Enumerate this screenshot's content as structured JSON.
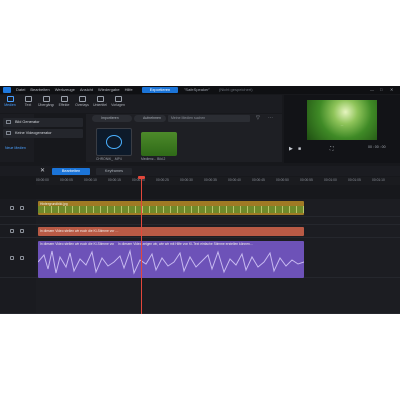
{
  "menu": {
    "items": [
      "Datei",
      "Bearbeiten",
      "Werkzeuge",
      "Ansicht",
      "Wiedergabe",
      "Hilfe"
    ]
  },
  "topbar": {
    "export_label": "Exportieren",
    "project_name": "\"SafeSpeaker\"",
    "project_status": "(Nicht gespeichert)"
  },
  "toolbar": {
    "tools": [
      "Medien",
      "Text",
      "Übergänge",
      "Effekte",
      "Overlays",
      "Untertitel",
      "Vorlagen"
    ]
  },
  "leftpanel": {
    "buttons": [
      "Bild Generator",
      "Keine Videogenerator"
    ],
    "link": "Neue Medien"
  },
  "media": {
    "tab_import": "Importieren",
    "tab_record": "Aufnehmen",
    "search_placeholder": "Meine Medien suchen",
    "thumb1_caption": "CHRONIK_ .MP4",
    "thumb2_caption": "Medienz... Bild.2"
  },
  "preview": {
    "overlay_text": "…",
    "timecode": "00 : 00 : 00"
  },
  "timeline": {
    "tabs": [
      "Bearbeiten",
      "Keyframes"
    ],
    "ticks": [
      "00:00:00",
      "00:00:05",
      "00:00:10",
      "00:00:15",
      "00:00:20",
      "00:00:25",
      "00:00:30",
      "00:00:35",
      "00:00:40",
      "00:00:45",
      "00:00:50",
      "00:00:55",
      "00:01:00",
      "00:01:05",
      "00:01:10"
    ],
    "video_clip": "Hintergrundbild.jpg",
    "text_clip": "In diesem Video stellen wir euch die KI-Stimme vor …",
    "audio_clip_1": "In diesem Video stellen wir euch die KI-Stimme vor …",
    "audio_clip_2": "In diesem Video zeigen wir, wie wir mit Hilfe von KI-Text einfache Stimme erstellen können…"
  },
  "colors": {
    "accent": "#1b74d8",
    "video": "#a07a24",
    "text": "#b85a45",
    "audio": "#6d52b8",
    "playhead": "#e2473b"
  }
}
